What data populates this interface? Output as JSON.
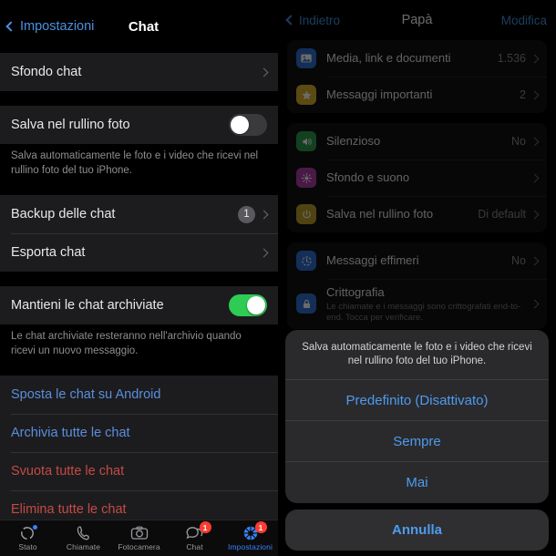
{
  "left": {
    "nav": {
      "back_label": "Impostazioni",
      "title": "Chat"
    },
    "groups": [
      {
        "rows": [
          {
            "label": "Sfondo chat",
            "accessory": "chevron"
          }
        ]
      },
      {
        "rows": [
          {
            "label": "Salva nel rullino foto",
            "accessory": "toggle",
            "toggle_state": "off"
          }
        ],
        "footnote": "Salva automaticamente le foto e i video che ricevi nel rullino foto del tuo iPhone."
      },
      {
        "rows": [
          {
            "label": "Backup delle chat",
            "accessory": "badge-chevron",
            "badge": "1"
          },
          {
            "label": "Esporta chat",
            "accessory": "chevron"
          }
        ]
      },
      {
        "rows": [
          {
            "label": "Mantieni le chat archiviate",
            "accessory": "toggle",
            "toggle_state": "on"
          }
        ],
        "footnote": "Le chat archiviate resteranno nell'archivio quando ricevi un nuovo messaggio."
      },
      {
        "rows": [
          {
            "label": "Sposta le chat su Android",
            "style": "blue"
          },
          {
            "label": "Archivia tutte le chat",
            "style": "blue"
          },
          {
            "label": "Svuota tutte le chat",
            "style": "red"
          },
          {
            "label": "Elimina tutte le chat",
            "style": "red"
          }
        ]
      }
    ],
    "tabbar": [
      {
        "label": "Stato",
        "icon": "status-icon",
        "badge": "",
        "dot": true,
        "active": false
      },
      {
        "label": "Chiamate",
        "icon": "phone-icon",
        "badge": "",
        "dot": false,
        "active": false
      },
      {
        "label": "Fotocamera",
        "icon": "camera-icon",
        "badge": "",
        "dot": false,
        "active": false
      },
      {
        "label": "Chat",
        "icon": "chats-icon",
        "badge": "1",
        "dot": false,
        "active": false
      },
      {
        "label": "Impostazioni",
        "icon": "settings-gear-icon",
        "badge": "1",
        "dot": false,
        "active": true
      }
    ]
  },
  "right": {
    "nav": {
      "back_label": "Indietro",
      "title": "Papà",
      "edit_label": "Modifica"
    },
    "cards": [
      {
        "rows": [
          {
            "icon": "photos-icon",
            "color": "#2f6fd0",
            "glyph": "☒",
            "title": "Media, link e documenti",
            "value": "1.536",
            "chevron": true
          },
          {
            "icon": "star-icon",
            "color": "#d8b129",
            "glyph": "★",
            "title": "Messaggi importanti",
            "value": "2",
            "chevron": true
          }
        ]
      },
      {
        "rows": [
          {
            "icon": "speaker-icon",
            "color": "#2e9b4c",
            "glyph": "🔊",
            "title": "Silenzioso",
            "value": "No",
            "chevron": true
          },
          {
            "icon": "wallpaper-icon",
            "color": "#b03fa8",
            "glyph": "✻",
            "title": "Sfondo e suono",
            "value": "",
            "chevron": true
          },
          {
            "icon": "save-camera-roll-icon",
            "color": "#bba02a",
            "glyph": "⏻",
            "title": "Salva nel rullino foto",
            "value": "Di default",
            "chevron": true
          }
        ]
      },
      {
        "rows": [
          {
            "icon": "disappearing-messages-icon",
            "color": "#2f6fd0",
            "glyph": "◔",
            "title": "Messaggi effimeri",
            "value": "No",
            "chevron": true
          },
          {
            "icon": "lock-icon",
            "color": "#2f6fd0",
            "glyph": "🔒",
            "title": "Crittografia",
            "subtitle": "Le chiamate e i messaggi sono crittografati end-to-end. Tocca per verificare.",
            "value": "",
            "chevron": true
          }
        ]
      }
    ],
    "action_sheet": {
      "header": "Salva automaticamente le foto e i video che ricevi nel rullino foto del tuo iPhone.",
      "options": [
        {
          "label": "Predefinito (Disattivato)"
        },
        {
          "label": "Sempre"
        },
        {
          "label": "Mai"
        }
      ],
      "cancel_label": "Annulla"
    }
  },
  "colors": {
    "accent_blue": "#4a90e2",
    "destructive_red": "#c54a45",
    "toggle_on_green": "#2ecc54",
    "badge_red": "#ff3b30"
  }
}
